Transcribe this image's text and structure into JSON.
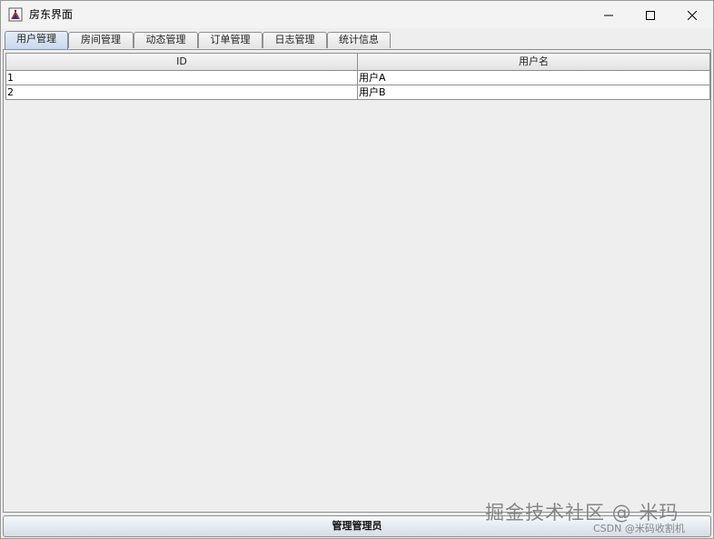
{
  "window": {
    "title": "房东界面"
  },
  "tabs": [
    {
      "label": "用户管理",
      "active": true
    },
    {
      "label": "房间管理",
      "active": false
    },
    {
      "label": "动态管理",
      "active": false
    },
    {
      "label": "订单管理",
      "active": false
    },
    {
      "label": "日志管理",
      "active": false
    },
    {
      "label": "统计信息",
      "active": false
    }
  ],
  "table": {
    "columns": [
      "ID",
      "用户名"
    ],
    "rows": [
      [
        "1",
        "用户A"
      ],
      [
        "2",
        "用户B"
      ]
    ]
  },
  "bottom_button": {
    "label": "管理管理员"
  },
  "watermark": {
    "main": "掘金技术社区 @ 米玛",
    "sub": "CSDN @米码收割机"
  },
  "colors": {
    "active_tab": "#c7d8ee",
    "close_icon": "#000000"
  }
}
